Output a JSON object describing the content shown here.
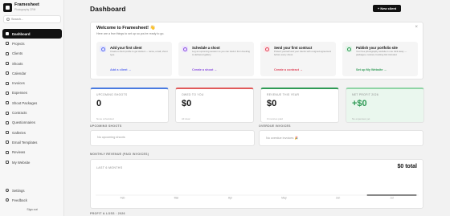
{
  "brand": {
    "name": "Framesheet",
    "subtitle": "Photography CRM"
  },
  "search": {
    "placeholder": "Search..."
  },
  "nav": {
    "items": [
      {
        "label": "Dashboard",
        "icon": "home-icon"
      },
      {
        "label": "Projects",
        "icon": "folder-icon"
      },
      {
        "label": "Clients",
        "icon": "users-icon"
      },
      {
        "label": "Shoots",
        "icon": "camera-icon"
      },
      {
        "label": "Calendar",
        "icon": "calendar-icon"
      },
      {
        "label": "Invoices",
        "icon": "receipt-icon"
      },
      {
        "label": "Expenses",
        "icon": "wallet-icon"
      },
      {
        "label": "Shoot Packages",
        "icon": "package-icon"
      },
      {
        "label": "Contracts",
        "icon": "file-icon"
      },
      {
        "label": "Questionnaires",
        "icon": "list-icon"
      },
      {
        "label": "Galleries",
        "icon": "image-icon"
      },
      {
        "label": "Email Templates",
        "icon": "mail-icon"
      },
      {
        "label": "Reviews",
        "icon": "star-icon"
      },
      {
        "label": "My Website",
        "icon": "globe-icon"
      }
    ],
    "bottom": [
      {
        "label": "Settings",
        "icon": "gear-icon"
      },
      {
        "label": "Feedback",
        "icon": "chat-icon"
      }
    ],
    "signout": "Sign out"
  },
  "header": {
    "title": "Dashboard",
    "new_client": "+ New client"
  },
  "welcome": {
    "title": "Welcome to Framesheet! 👋",
    "subtitle": "Here are a few things to set up so you're ready to go.",
    "steps": [
      {
        "title": "Add your first client",
        "desc": "Create a client profile to get started — name, email, shoot type.",
        "link": "Add a client →",
        "color": "#5b6cf0",
        "bg": "#e6e8fd"
      },
      {
        "title": "Schedule a shoot",
        "desc": "Log an upcoming session so you can track it from booking to delivered gallery.",
        "link": "Create a shoot →",
        "color": "#8a4fe0",
        "bg": "#efe6fc"
      },
      {
        "title": "Send your first contract",
        "desc": "Protect yourself and your clients with a signed agreement before every shoot.",
        "link": "Create a contract →",
        "color": "#e0455a",
        "bg": "#fde6e9"
      },
      {
        "title": "Publish your portfolio site",
        "desc": "Your free photography website is one click away — packages, reviews, booking link included.",
        "link": "Set up My Website →",
        "color": "#2f9a55",
        "bg": "#e2f5e8"
      }
    ]
  },
  "kpis": [
    {
      "label": "UPCOMING SHOOTS",
      "value": "0",
      "sub": "None scheduled",
      "accent": "#4a7be0",
      "value_color": "#111",
      "bg": "#ffffff"
    },
    {
      "label": "OWED TO YOU",
      "value": "$0",
      "sub": "All clear",
      "accent": "#e05a5a",
      "value_color": "#111",
      "bg": "#ffffff"
    },
    {
      "label": "REVENUE THIS YEAR",
      "value": "$0",
      "sub": "0 invoices paid",
      "accent": "#2f9a55",
      "value_color": "#111",
      "bg": "#ffffff"
    },
    {
      "label": "NET PROFIT 2026",
      "value": "+$0",
      "sub": "No expenses yet",
      "accent": "#8fd4a5",
      "value_color": "#2f9a55",
      "bg": "#eaf7ee"
    }
  ],
  "upcoming": {
    "label": "UPCOMING SHOOTS",
    "empty": "No upcoming shoots"
  },
  "overdue": {
    "label": "OVERDUE INVOICES",
    "empty": "No overdue invoices 🎉"
  },
  "revenue": {
    "label": "MONTHLY REVENUE (PAID INVOICES)",
    "range": "LAST 6 MONTHS",
    "total": "$0 total"
  },
  "bottom_label": "PROFIT & LOSS · 2026",
  "chart_data": {
    "type": "bar",
    "categories": [
      "Feb",
      "Mar",
      "Apr",
      "May",
      "Jun",
      "Jul"
    ],
    "values": [
      0,
      0,
      0,
      0,
      0,
      0
    ],
    "highlight_color": "#111111"
  }
}
